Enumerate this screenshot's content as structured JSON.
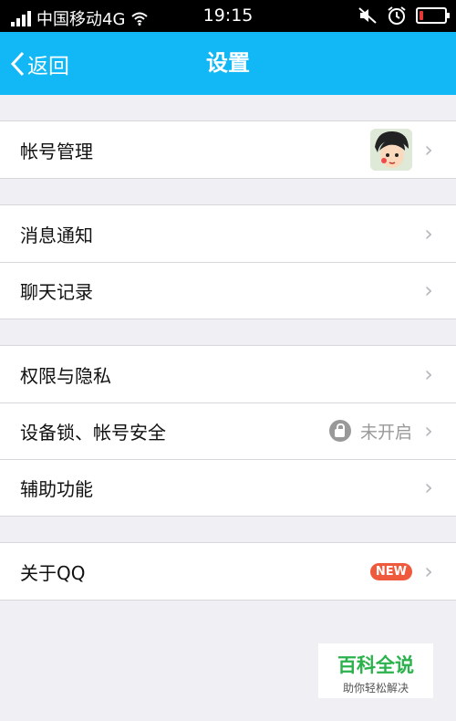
{
  "status_bar": {
    "carrier": "中国移动4G",
    "time": "19:15",
    "battery_level": 0.15
  },
  "nav": {
    "back_label": "返回",
    "title": "设置"
  },
  "groups": [
    {
      "items": [
        {
          "label": "帐号管理",
          "accessory": "avatar"
        }
      ]
    },
    {
      "items": [
        {
          "label": "消息通知"
        },
        {
          "label": "聊天记录"
        }
      ]
    },
    {
      "items": [
        {
          "label": "权限与隐私"
        },
        {
          "label": "设备锁、帐号安全",
          "status": "未开启",
          "accessory": "lock-icon"
        },
        {
          "label": "辅助功能"
        }
      ]
    },
    {
      "items": [
        {
          "label": "关于QQ",
          "badge": "NEW"
        }
      ]
    }
  ],
  "watermark": {
    "title": "百科全说",
    "subtitle": "助你轻松解决"
  },
  "colors": {
    "nav_bg": "#12b7f5",
    "badge": "#f05a3c",
    "watermark_green": "#2bb24c"
  }
}
